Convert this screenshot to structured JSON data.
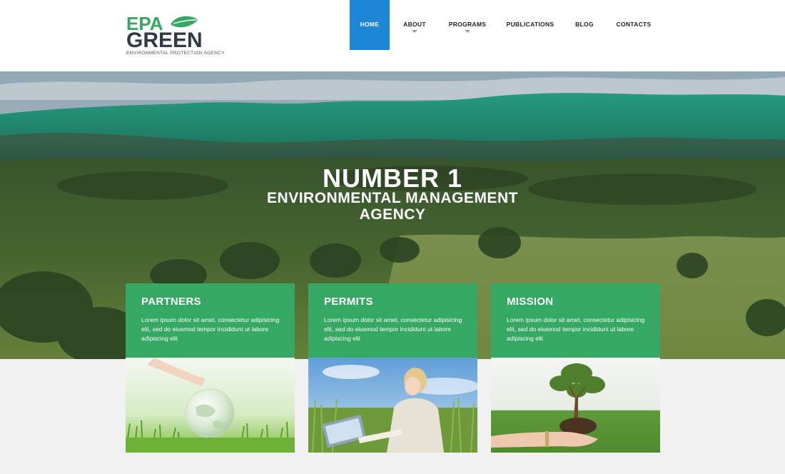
{
  "logo": {
    "line1": "EPA",
    "line2": "GREEN",
    "tagline": "ENVIRONMENTAL PROTECTION AGENCY",
    "brand_green": "#35a864",
    "brand_dark": "#2f3a44",
    "leaf_icon": "leaf-icon"
  },
  "nav": {
    "accent": "#1e86d6",
    "items": [
      {
        "label": "HOME",
        "active": true
      },
      {
        "label": "ABOUT",
        "has_dropdown": true
      },
      {
        "label": "PROGRAMS",
        "has_dropdown": true
      },
      {
        "label": "PUBLICATIONS"
      },
      {
        "label": "BLOG"
      },
      {
        "label": "CONTACTS"
      }
    ]
  },
  "hero": {
    "title": "NUMBER 1",
    "subtitle_line1": "ENVIRONMENTAL MANAGEMENT",
    "subtitle_line2": "AGENCY"
  },
  "cards": [
    {
      "title": "PARTNERS",
      "text": "Lorem ipsum dolor sit amet, consectetur adipisicing elit, sed do eiusmod tempor incididunt ut labore adipiscing elit"
    },
    {
      "title": "PERMITS",
      "text": "Lorem ipsum dolor sit amet, consectetur adipisicing elit, sed do eiusmod tempor incididunt ut labore adipiscing elit"
    },
    {
      "title": "MISSION",
      "text": "Lorem ipsum dolor sit amet, consectetur adipisicing elit, sed do eiusmod tempor incididunt ut labore adipiscing elit"
    }
  ],
  "card_green": "#35a864"
}
